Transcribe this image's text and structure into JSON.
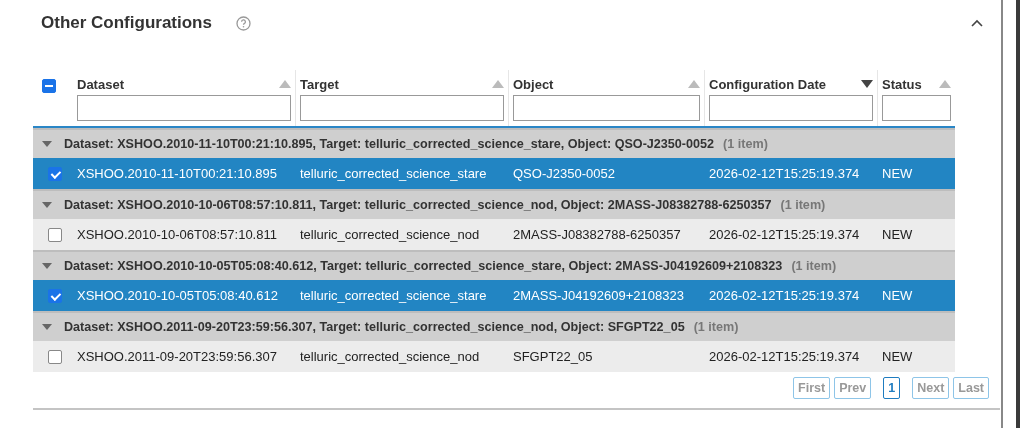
{
  "section": {
    "title": "Other Configurations",
    "expanded": true
  },
  "table": {
    "select_all_partial": true,
    "columns": [
      {
        "label": "Dataset",
        "sorted": false
      },
      {
        "label": "Target",
        "sorted": false
      },
      {
        "label": "Object",
        "sorted": false
      },
      {
        "label": "Configuration Date",
        "sorted": true
      },
      {
        "label": "Status",
        "sorted": false
      }
    ],
    "groups": [
      {
        "label": "Dataset: XSHOO.2010-11-10T00:21:10.895, Target: telluric_corrected_science_stare, Object: QSO-J2350-0052",
        "count": "(1 item)",
        "expanded": true,
        "rows": [
          {
            "checked": true,
            "cells": [
              "XSHOO.2010-11-10T00:21:10.895",
              "telluric_corrected_science_stare",
              "QSO-J2350-0052",
              "2026-02-12T15:25:19.374",
              "NEW"
            ]
          }
        ]
      },
      {
        "label": "Dataset: XSHOO.2010-10-06T08:57:10.811, Target: telluric_corrected_science_nod, Object: 2MASS-J08382788-6250357",
        "count": "(1 item)",
        "expanded": true,
        "rows": [
          {
            "checked": false,
            "cells": [
              "XSHOO.2010-10-06T08:57:10.811",
              "telluric_corrected_science_nod",
              "2MASS-J08382788-6250357",
              "2026-02-12T15:25:19.374",
              "NEW"
            ]
          }
        ]
      },
      {
        "label": "Dataset: XSHOO.2010-10-05T05:08:40.612, Target: telluric_corrected_science_stare, Object: 2MASS-J04192609+2108323",
        "count": "(1 item)",
        "expanded": true,
        "rows": [
          {
            "checked": true,
            "cells": [
              "XSHOO.2010-10-05T05:08:40.612",
              "telluric_corrected_science_stare",
              "2MASS-J04192609+2108323",
              "2026-02-12T15:25:19.374",
              "NEW"
            ]
          }
        ]
      },
      {
        "label": "Dataset: XSHOO.2011-09-20T23:59:56.307, Target: telluric_corrected_science_nod, Object: SFGPT22_05",
        "count": "(1 item)",
        "expanded": true,
        "rows": [
          {
            "checked": false,
            "cells": [
              "XSHOO.2011-09-20T23:59:56.307",
              "telluric_corrected_science_nod",
              "SFGPT22_05",
              "2026-02-12T15:25:19.374",
              "NEW"
            ]
          }
        ]
      }
    ]
  },
  "pager": [
    {
      "label": "First",
      "kind": "nav",
      "disabled": true
    },
    {
      "label": "Prev",
      "kind": "nav",
      "disabled": true
    },
    {
      "label": "1",
      "kind": "page",
      "selected": true
    },
    {
      "label": "Next",
      "kind": "nav",
      "disabled": true
    },
    {
      "label": "Last",
      "kind": "nav",
      "disabled": true
    }
  ]
}
